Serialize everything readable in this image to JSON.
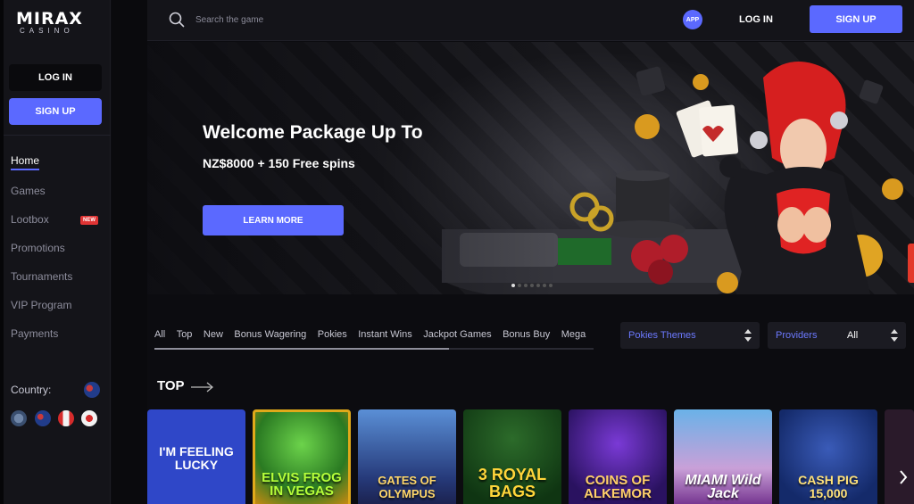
{
  "brand": {
    "logo_main": "MIRAX",
    "logo_sub": "CASINO"
  },
  "sidebar": {
    "login_label": "LOG IN",
    "signup_label": "SIGN UP",
    "nav": [
      {
        "label": "Home",
        "active": true
      },
      {
        "label": "Games"
      },
      {
        "label": "Lootbox",
        "badge": "NEW"
      },
      {
        "label": "Promotions"
      },
      {
        "label": "Tournaments"
      },
      {
        "label": "VIP Program"
      },
      {
        "label": "Payments"
      }
    ],
    "country_label": "Country:",
    "flag_icons": [
      "globe-flag-icon",
      "australia-flag-icon",
      "canada-flag-icon",
      "japan-flag-icon"
    ]
  },
  "topbar": {
    "search_placeholder": "Search the game",
    "app_label": "APP",
    "login_label": "LOG IN",
    "signup_label": "SIGN UP"
  },
  "hero": {
    "title": "Welcome Package Up To",
    "subtitle": "NZ$8000 + 150 Free spins",
    "cta_label": "LEARN MORE",
    "slides_total": 7,
    "active_slide": 1
  },
  "filters": {
    "tabs": [
      "All",
      "Top",
      "New",
      "Bonus Wagering",
      "Pokies",
      "Instant Wins",
      "Jackpot Games",
      "Bonus Buy",
      "Mega"
    ],
    "themes_select": {
      "label": "Pokies Themes"
    },
    "providers_select": {
      "label": "Providers",
      "value": "All"
    }
  },
  "top_section": {
    "title": "TOP",
    "games": [
      {
        "name": "I'M FEELING LUCKY"
      },
      {
        "name": "ELVIS FROG IN VEGAS"
      },
      {
        "name": "GATES OF OLYMPUS"
      },
      {
        "name": "3 ROYAL BAGS"
      },
      {
        "name": "COINS OF ALKEMOR"
      },
      {
        "name": "MIAMI Wild Jack"
      },
      {
        "name": "CASH PIG 15,000"
      }
    ]
  },
  "colors": {
    "accent": "#5b69ff",
    "sidebar_bg": "#141419",
    "page_bg": "#0c0c10",
    "badge": "#e03434"
  }
}
